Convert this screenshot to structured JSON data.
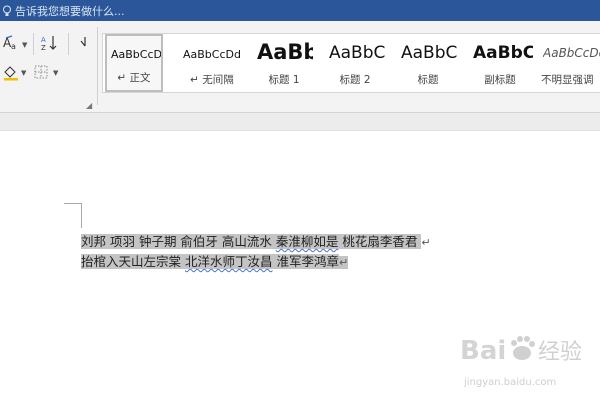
{
  "tell_me": {
    "text": "告诉我您想要做什么..."
  },
  "styles": [
    {
      "preview": "AaBbCcDd",
      "label": "↵ 正文"
    },
    {
      "preview": "AaBbCcDd",
      "label": "↵ 无间隔"
    },
    {
      "preview": "AaBb",
      "label": "标题 1"
    },
    {
      "preview": "AaBbC",
      "label": "标题 2"
    },
    {
      "preview": "AaBbC",
      "label": "标题"
    },
    {
      "preview": "AaBbC",
      "label": "副标题"
    },
    {
      "preview": "AaBbCcDd",
      "label": "不明显强调"
    }
  ],
  "document": {
    "line1": {
      "segments": [
        "刘邦 项羽 钟子期 俞伯牙 高山流水 ",
        "秦淮柳如是",
        " 桃花扇李香君 "
      ],
      "para_mark": "↵"
    },
    "line2": {
      "segments": [
        "抬棺入天山左宗棠 ",
        "北洋水师丁汝昌",
        " 淮军李鸿章"
      ],
      "para_mark": "↵"
    }
  },
  "watermark": {
    "brand": "Baidu经验",
    "url": "jingyan.baidu.com"
  },
  "colors": {
    "title_bar": "#2b579a",
    "ribbon": "#f3f3f3",
    "selection": "#c4c4c4",
    "spell_squiggle": "#4a6fd8"
  }
}
